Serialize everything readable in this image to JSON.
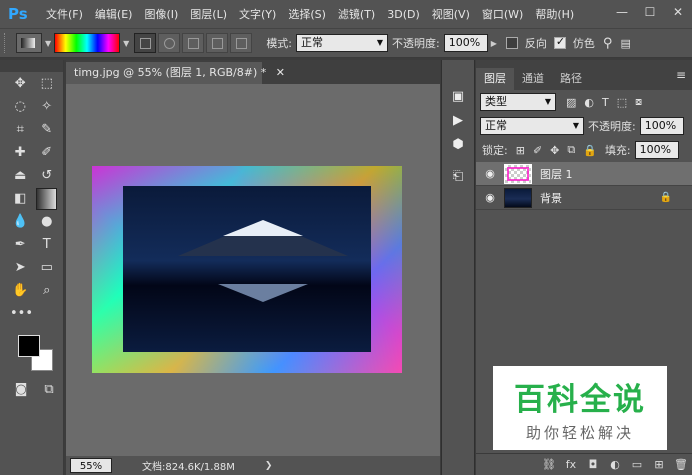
{
  "app": {
    "logo": "Ps"
  },
  "menu": [
    "文件(F)",
    "编辑(E)",
    "图像(I)",
    "图层(L)",
    "文字(Y)",
    "选择(S)",
    "滤镜(T)",
    "3D(D)",
    "视图(V)",
    "窗口(W)",
    "帮助(H)"
  ],
  "window_controls": [
    "—",
    "☐",
    "✕"
  ],
  "options": {
    "mode_label": "模式:",
    "mode_value": "正常",
    "opacity_label": "不透明度:",
    "opacity_value": "100%",
    "reverse_label": "反向",
    "dither_label": "仿色",
    "reverse_checked": false,
    "dither_checked": true
  },
  "document": {
    "tab_title": "timg.jpg @ 55% (图层 1, RGB/8#) *",
    "zoom": "55%",
    "doc_info": "文档:824.6K/1.88M"
  },
  "layers_panel": {
    "tabs": [
      "图层",
      "通道",
      "路径"
    ],
    "filter_kind": "类型",
    "blend_mode": "正常",
    "opacity_label": "不透明度:",
    "opacity_value": "100%",
    "lock_label": "锁定:",
    "fill_label": "填充:",
    "fill_value": "100%",
    "layers": [
      {
        "name": "图层 1",
        "selected": true
      },
      {
        "name": "背景",
        "selected": false,
        "locked": true
      }
    ]
  },
  "watermark": {
    "title": "百科全说",
    "subtitle": "助你轻松解决"
  }
}
